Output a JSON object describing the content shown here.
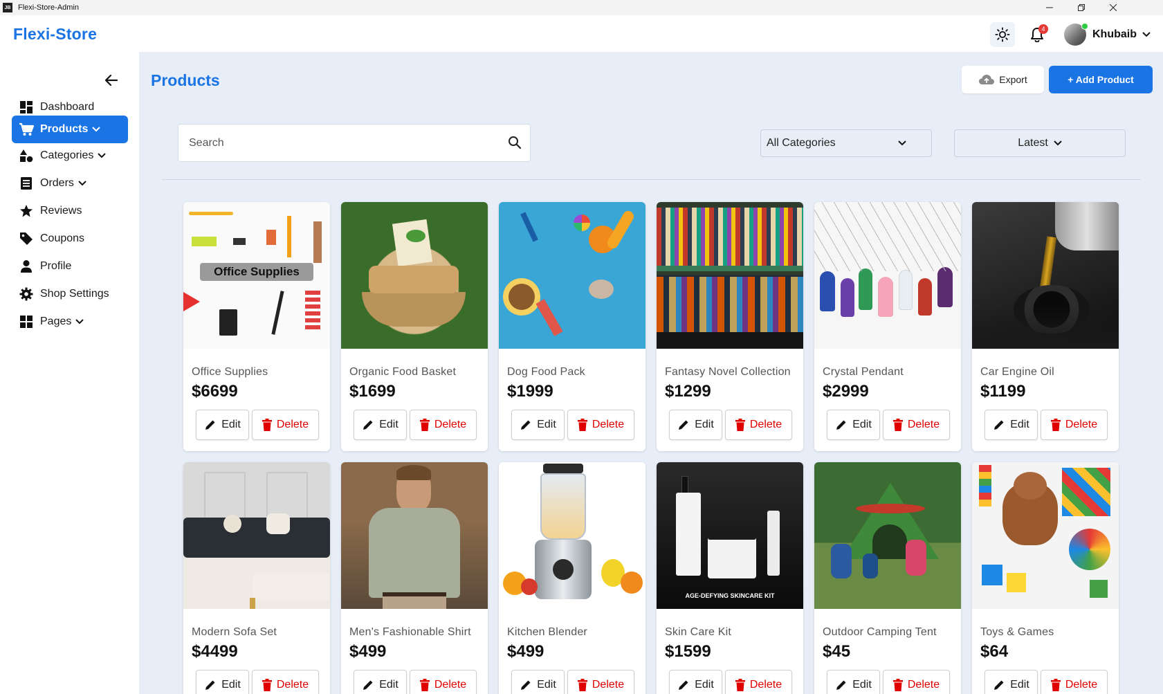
{
  "window": {
    "title": "Flexi-Store-Admin",
    "icon_text": "JB"
  },
  "header": {
    "brand": "Flexi-Store",
    "notification_count": "4",
    "user_name": "Khubaib"
  },
  "sidebar": {
    "items": [
      {
        "label": "Dashboard",
        "icon": "dashboard-icon"
      },
      {
        "label": "Products",
        "icon": "cart-icon"
      },
      {
        "label": "Categories",
        "icon": "shapes-icon"
      },
      {
        "label": "Orders",
        "icon": "list-icon"
      },
      {
        "label": "Reviews",
        "icon": "star-icon"
      },
      {
        "label": "Coupons",
        "icon": "tag-icon"
      },
      {
        "label": "Profile",
        "icon": "person-icon"
      },
      {
        "label": "Shop Settings",
        "icon": "gear-icon"
      },
      {
        "label": "Pages",
        "icon": "pages-icon"
      }
    ]
  },
  "main": {
    "title": "Products",
    "export_label": "Export",
    "add_label": "+ Add Product",
    "search_placeholder": "Search",
    "category_filter": "All Categories",
    "sort_filter": "Latest",
    "edit_label": "Edit",
    "delete_label": "Delete"
  },
  "products": [
    {
      "name": "Office Supplies",
      "price": "$6699",
      "image_text": "Office Supplies"
    },
    {
      "name": "Organic Food Basket",
      "price": "$1699"
    },
    {
      "name": "Dog Food Pack",
      "price": "$1999"
    },
    {
      "name": "Fantasy Novel Collection",
      "price": "$1299"
    },
    {
      "name": "Crystal Pendant",
      "price": "$2999"
    },
    {
      "name": "Car Engine Oil",
      "price": "$1199"
    },
    {
      "name": "Modern Sofa Set",
      "price": "$4499"
    },
    {
      "name": "Men's Fashionable Shirt",
      "price": "$499"
    },
    {
      "name": "Kitchen Blender",
      "price": "$499"
    },
    {
      "name": "Skin Care Kit",
      "price": "$1599",
      "image_text": "AGE-DEFYING SKINCARE KIT"
    },
    {
      "name": "Outdoor Camping Tent",
      "price": "$45"
    },
    {
      "name": "Toys & Games",
      "price": "$64"
    }
  ],
  "colors": {
    "accent": "#1b74e4",
    "danger": "#e00000",
    "main_bg": "#e8eef7"
  }
}
